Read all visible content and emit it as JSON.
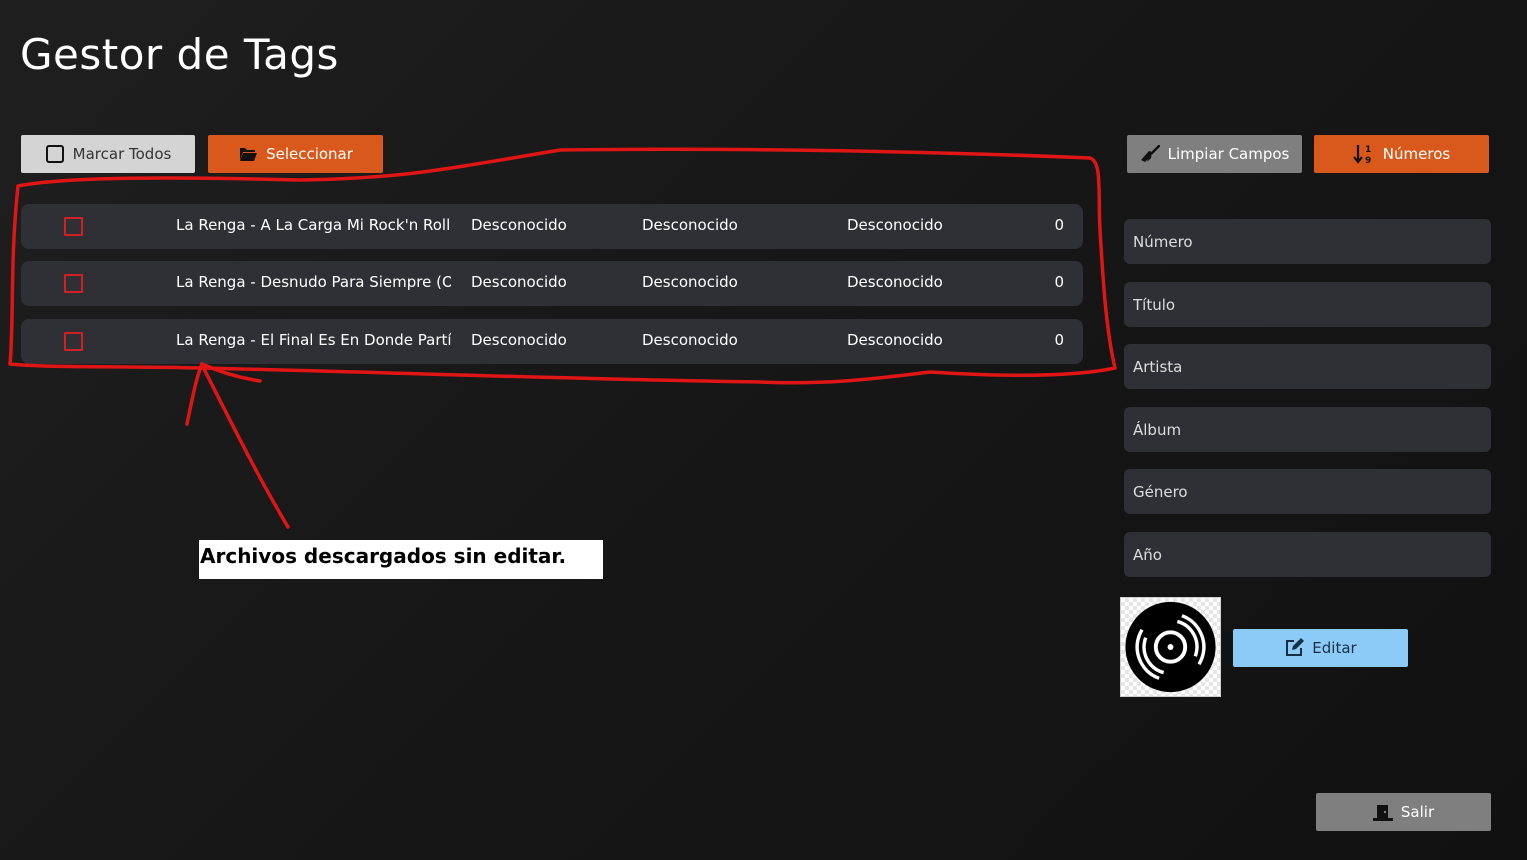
{
  "app": {
    "title": "Gestor de Tags"
  },
  "toolbar": {
    "mark_all": "Marcar Todos",
    "select": "Seleccionar",
    "clear_fields": "Limpiar Campos",
    "numbers": "Números"
  },
  "files": [
    {
      "name": "La Renga - A La Carga Mi Rock'n Roll",
      "artist": "Desconocido",
      "album": "Desconocido",
      "genre": "Desconocido",
      "number": "0",
      "checked": false
    },
    {
      "name": "La Renga - Desnudo Para Siempre (O Desnudo)",
      "artist": "Desconocido",
      "album": "Desconocido",
      "genre": "Desconocido",
      "number": "0",
      "checked": false
    },
    {
      "name": "La Renga - El Final Es En Donde Partí",
      "artist": "Desconocido",
      "album": "Desconocido",
      "genre": "Desconocido",
      "number": "0",
      "checked": false
    }
  ],
  "form": {
    "numero": {
      "placeholder": "Número",
      "value": ""
    },
    "titulo": {
      "placeholder": "Título",
      "value": ""
    },
    "artista": {
      "placeholder": "Artista",
      "value": ""
    },
    "album": {
      "placeholder": "Álbum",
      "value": ""
    },
    "genero": {
      "placeholder": "Género",
      "value": ""
    },
    "anio": {
      "placeholder": "Año",
      "value": ""
    }
  },
  "edit_button": "Editar",
  "exit_button": "Salir",
  "annotation": {
    "text": "Archivos descargados sin editar."
  },
  "icons": {
    "mark_all": "checkbox-square-icon",
    "select": "folder-open-icon",
    "clear_fields": "broom-icon",
    "numbers": "sort-numeric-icon",
    "edit": "edit-icon",
    "exit": "door-exit-icon",
    "cover": "vinyl-record-icon"
  },
  "colors": {
    "accent_orange": "#d9591c",
    "edit_blue": "#8ccbf8",
    "checkbox_red": "#d02020",
    "annotation_red": "#e01515",
    "row_bg": "#2e3035"
  }
}
